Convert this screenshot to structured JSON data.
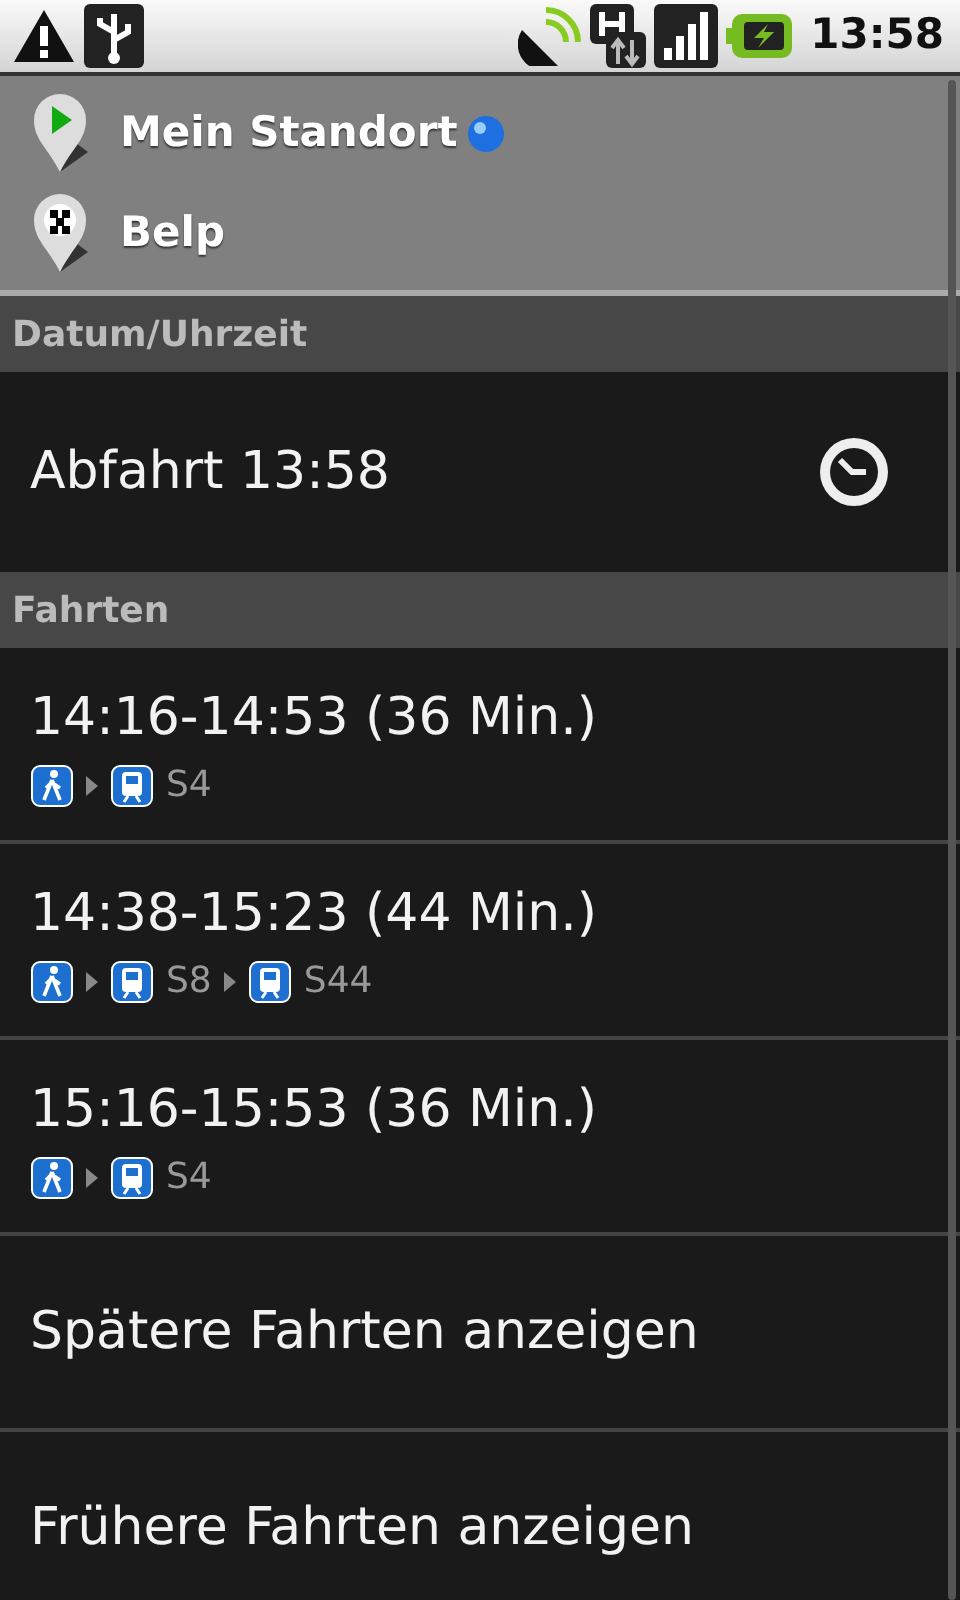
{
  "status_bar": {
    "time": "13:58"
  },
  "route": [
    {
      "kind": "start",
      "label": "Mein Standort",
      "located": true
    },
    {
      "kind": "destination",
      "label": "Belp",
      "located": false
    }
  ],
  "sections": [
    {
      "title": "Datum/Uhrzeit"
    },
    {
      "title": "Fahrten"
    }
  ],
  "departure": {
    "label": "Abfahrt 13:58"
  },
  "trips": [
    {
      "time": "14:16-14:53 (36 Min.)",
      "legs": [
        {
          "kind": "walk"
        },
        {
          "kind": "train",
          "line": "S4"
        }
      ]
    },
    {
      "time": "14:38-15:23 (44 Min.)",
      "legs": [
        {
          "kind": "walk"
        },
        {
          "kind": "train",
          "line": "S8"
        },
        {
          "kind": "train",
          "line": "S44"
        }
      ]
    },
    {
      "time": "15:16-15:53 (36 Min.)",
      "legs": [
        {
          "kind": "walk"
        },
        {
          "kind": "train",
          "line": "S4"
        }
      ]
    }
  ],
  "more": [
    {
      "label": "Spätere Fahrten anzeigen"
    },
    {
      "label": "Frühere Fahrten anzeigen"
    }
  ]
}
